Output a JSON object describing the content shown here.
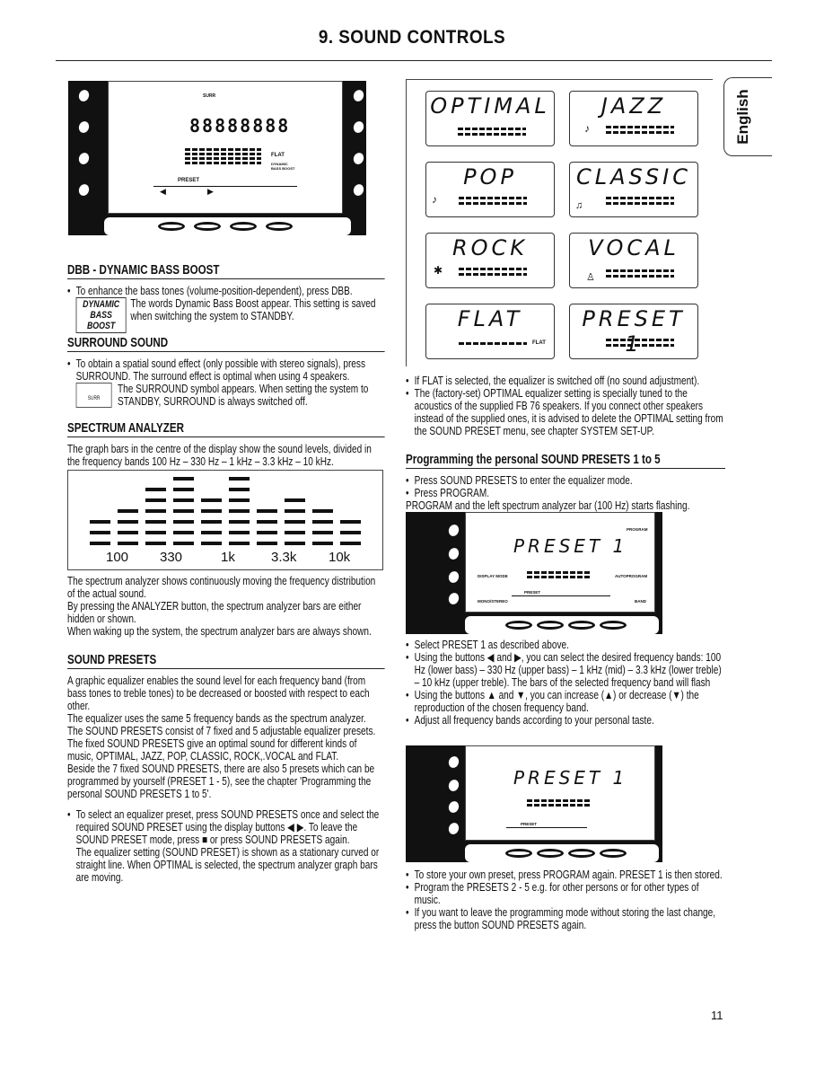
{
  "page": {
    "title": "9. SOUND CONTROLS",
    "page_number": "11",
    "language_tab": "English"
  },
  "display_top": {
    "surr": "SURR",
    "flat": "FLAT",
    "dbb": "DYNAMIC BASS BOOST",
    "preset": "PRESET",
    "digits": "88888888"
  },
  "dbb": {
    "heading": "DBB - DYNAMIC BASS BOOST",
    "text1": "To enhance the bass tones (volume-position-dependent), press DBB.",
    "logo": "DYNAMIC BASS BOOST",
    "text2": "The words Dynamic Bass Boost appear. This setting is saved when switching the system to STANDBY."
  },
  "surround": {
    "heading": "SURROUND SOUND",
    "text1": "To obtain a spatial sound effect (only possible with stereo signals), press SURROUND. The surround effect is optimal when using 4 speakers.",
    "icon_label": "SURR",
    "text2": "The SURROUND symbol appears. When setting the system to STANDBY, SURROUND is always switched off."
  },
  "spectrum": {
    "heading": "SPECTRUM ANALYZER",
    "text": "The graph bars in the centre of the display show the sound levels, divided in the frequency bands 100 Hz – 330 Hz – 1 kHz – 3.3 kHz – 10 kHz.",
    "figure": {
      "labels": [
        "100",
        "330",
        "1k",
        "3.3k",
        "10k"
      ],
      "bar_levels": [
        3,
        4,
        6,
        7,
        5,
        7,
        4,
        5,
        4,
        3
      ]
    },
    "p1": "The spectrum analyzer shows continuously moving the frequency distribution of the actual sound.",
    "p2": "By pressing the ANALYZER button, the spectrum analyzer bars are either hidden or shown.",
    "p3": "When waking up the system, the spectrum analyzer bars are always shown."
  },
  "presets": {
    "heading": "SOUND PRESETS",
    "p1": "A graphic equalizer enables the sound level for each frequency band (from bass tones to treble tones) to be decreased or boosted with respect to each other.",
    "p2": "The equalizer uses the same 5 frequency bands as the spectrum analyzer.",
    "p3": "The SOUND PRESETS consist of 7 fixed and 5 adjustable equalizer presets.",
    "p4": "The fixed SOUND PRESETS give an optimal sound for different kinds of music, OPTIMAL, JAZZ, POP, CLASSIC, ROCK,.VOCAL and FLAT.",
    "p5": "Beside the 7 fixed SOUND PRESETS, there are also 5 presets which can be programmed by yourself (PRESET 1 - 5), see the chapter 'Programming the personal SOUND PRESETS 1 to 5'.",
    "b1": "To select an equalizer preset, press SOUND PRESETS once and select the required SOUND PRESET using the display buttons ◀ ▶. To leave the SOUND PRESET mode, press ■ or press SOUND PRESETS again.",
    "b1b": "The equalizer setting (SOUND PRESET) is shown as a stationary curved or straight line. When OPTIMAL is selected, the spectrum analyzer graph bars are moving."
  },
  "preset_boxes": [
    {
      "name": "OPTIMAL"
    },
    {
      "name": "JAZZ"
    },
    {
      "name": "POP"
    },
    {
      "name": "CLASSIC"
    },
    {
      "name": "ROCK"
    },
    {
      "name": "VOCAL"
    },
    {
      "name": "FLAT",
      "tag": "FLAT"
    },
    {
      "name": "PRESET 1"
    }
  ],
  "right": {
    "b1": "If FLAT is selected, the equalizer is switched off (no sound adjustment).",
    "b2": "The (factory-set) OPTIMAL equalizer setting is specially tuned to the acoustics of the supplied FB 76 speakers. If you connect other speakers instead of the supplied ones, it is advised to delete the OPTIMAL setting from the SOUND PRESET menu, see chapter SYSTEM SET-UP.",
    "prog_heading": "Programming the personal SOUND PRESETS 1 to 5",
    "p1": "Press SOUND PRESETS to enter the equalizer mode.",
    "p2": "Press PROGRAM.",
    "p2b": "PROGRAM and the left spectrum analyzer bar (100 Hz) starts flashing.",
    "s1": "Select PRESET 1 as described above.",
    "s2": "Using the buttons ◀ and ▶, you can select the desired frequency bands: 100 Hz (lower bass) – 330 Hz (upper bass) – 1 kHz (mid) – 3.3 kHz (lower treble) – 10 kHz (upper treble). The bars of the selected frequency band will flash",
    "s3": "Using the buttons ▲ and ▼, you can increase (▲) or decrease (▼) the reproduction of the chosen frequency band.",
    "s4": "Adjust all frequency bands according to your personal taste.",
    "t1": "To store your own preset, press PROGRAM again. PRESET 1 is then stored.",
    "t2": "Program the PRESETS 2 - 5 e.g. for other persons or for other types of music.",
    "t3": "If you want to leave the programming mode without storing the last change, press the button SOUND PRESETS again."
  },
  "display_prog": {
    "text": "PRESET 1",
    "program": "PROGRAM",
    "display_mode": "DISPLAY MODE",
    "autoprogram": "AUTOPROGRAM",
    "preset": "PRESET",
    "mono_stereo": "MONO/STEREO",
    "band": "BAND"
  },
  "display_prog2": {
    "text": "PRESET 1",
    "preset": "PRESET"
  }
}
